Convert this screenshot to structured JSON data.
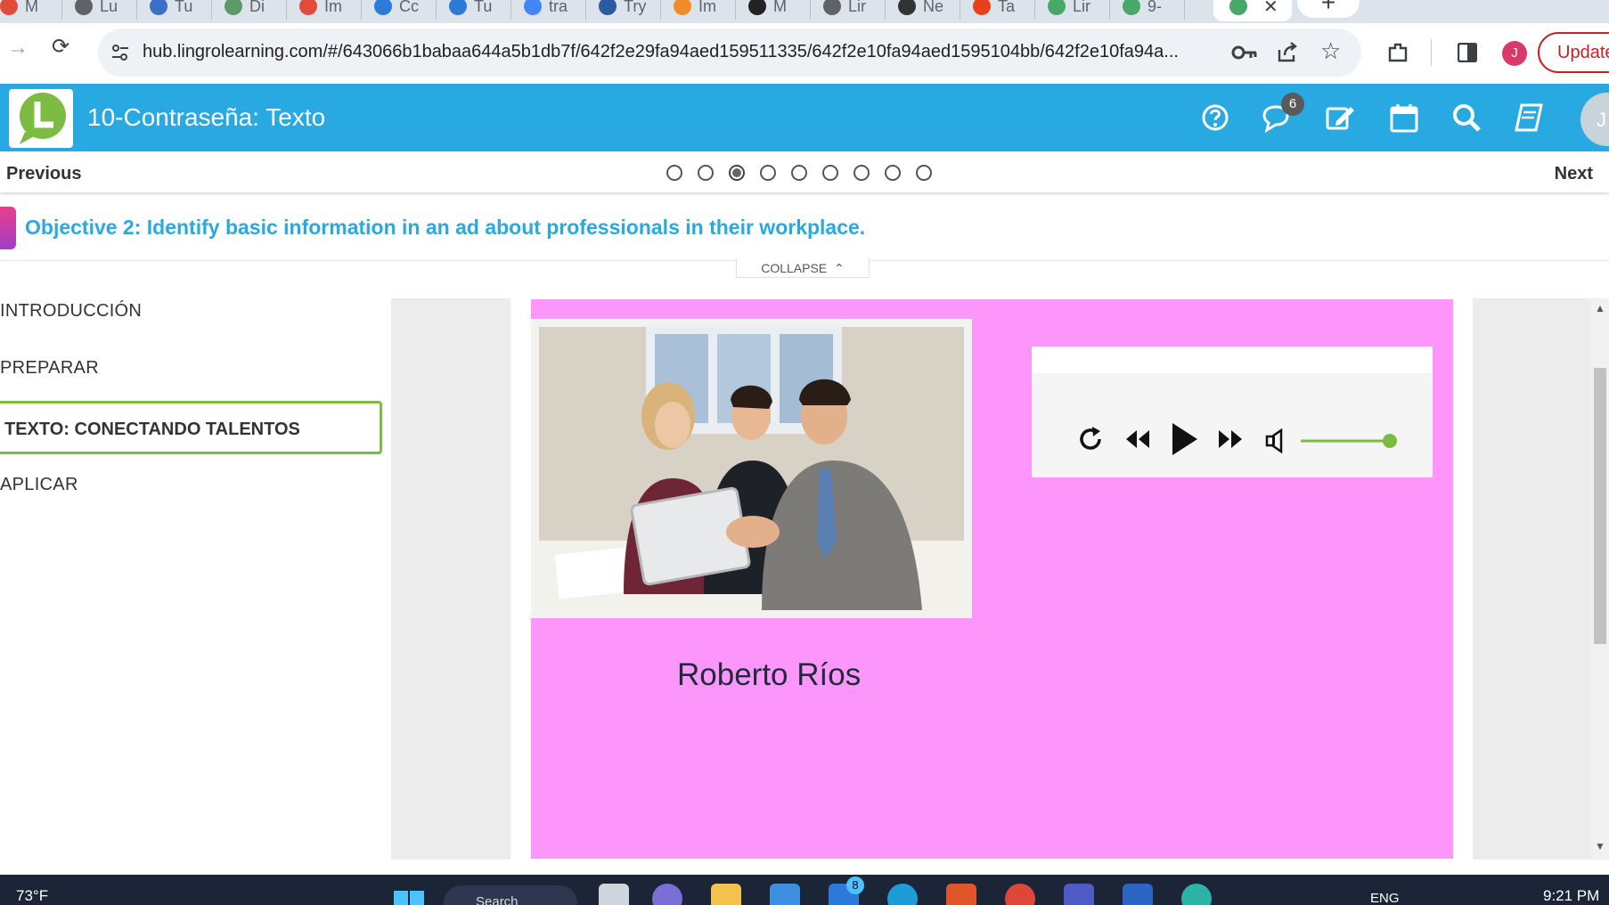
{
  "browser": {
    "tabs": [
      {
        "label": "M",
        "color": "#e04b3a"
      },
      {
        "label": "Lu",
        "color": "#5f6368"
      },
      {
        "label": "Tu",
        "color": "#3a6fc7"
      },
      {
        "label": "Di",
        "color": "#5a9a6a"
      },
      {
        "label": "Im",
        "color": "#e04b3a"
      },
      {
        "label": "Cc",
        "color": "#2d7bd8"
      },
      {
        "label": "Tu",
        "color": "#2d7bd8"
      },
      {
        "label": "tra",
        "color": "#4285f4"
      },
      {
        "label": "Try",
        "color": "#2c5aa0"
      },
      {
        "label": "Im",
        "color": "#f28c28"
      },
      {
        "label": "M",
        "color": "#222222"
      },
      {
        "label": "Lir",
        "color": "#5f6368"
      },
      {
        "label": "Ne",
        "color": "#333333"
      },
      {
        "label": "Ta",
        "color": "#e8401c"
      },
      {
        "label": "Lir",
        "color": "#48a868"
      },
      {
        "label": "9-",
        "color": "#48a868"
      }
    ],
    "active_tab_close": "✕",
    "new_tab": "+",
    "url": "hub.lingrolearning.com/#/643066b1babaa644a5b1db7f/642f2e29fa94aed159511335/642f2e10fa94aed1595104bb/642f2e10fa94a...",
    "profile_initial": "J",
    "update_label": "Update"
  },
  "app": {
    "title": "10-Contraseña: Texto",
    "messages_badge": "6",
    "header_color": "#29a9e1",
    "user_initial": "J"
  },
  "stepper": {
    "previous_label": "Previous",
    "next_label": "Next",
    "dot_count": 9,
    "active_index": 2
  },
  "objective": {
    "text": "Objective 2: Identify basic information in an ad about professionals in their workplace.",
    "collapse_label": "COLLAPSE"
  },
  "nav": {
    "items": [
      {
        "label": "INTRODUCCIÓN",
        "active": false
      },
      {
        "label": "PREPARAR",
        "active": false
      },
      {
        "label": "TEXTO: CONECTANDO TALENTOS",
        "active": true
      },
      {
        "label": "APLICAR",
        "active": false
      }
    ],
    "active_border_color": "#7dbb42"
  },
  "content": {
    "background_color": "#fd96fb",
    "person_name": "Roberto Ríos",
    "audio_player": {
      "volume_fraction": 1.0,
      "accent_color": "#7dbb42"
    }
  },
  "taskbar": {
    "weather": "73°F",
    "search_placeholder": "Search",
    "mail_badge": "8",
    "language": "ENG",
    "time": "9:21 PM"
  }
}
